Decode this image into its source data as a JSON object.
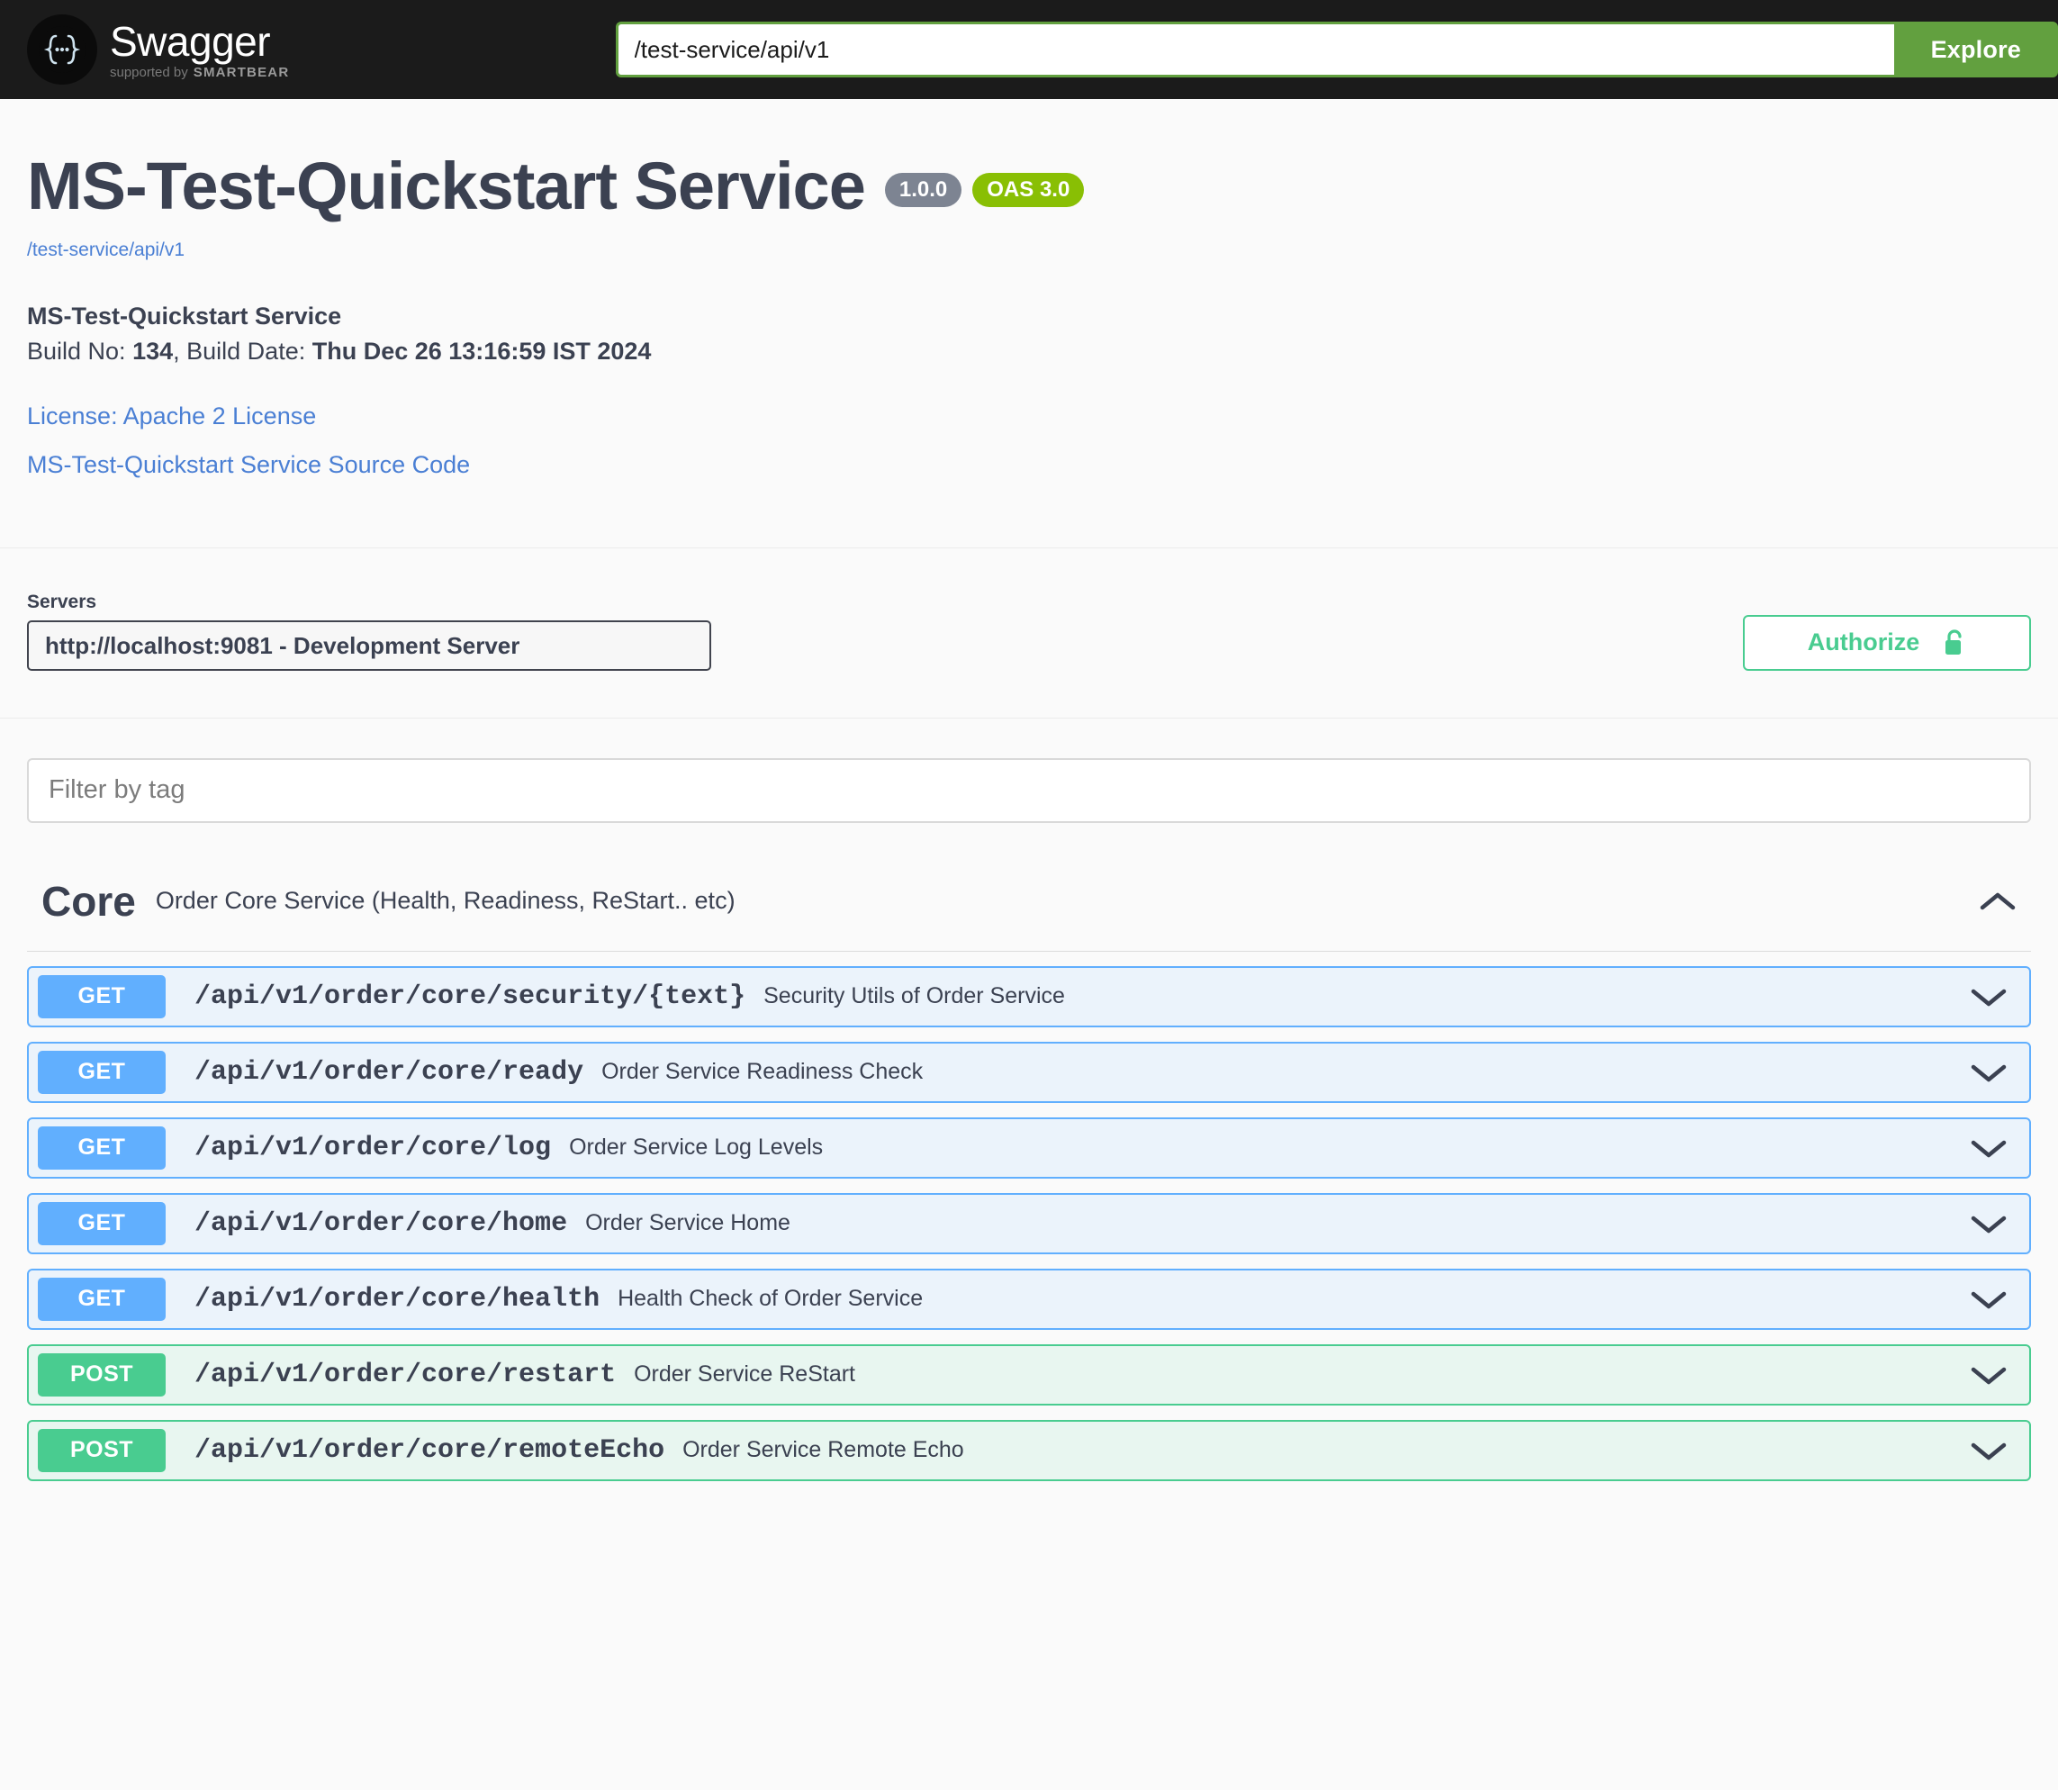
{
  "topbar": {
    "logo_title": "Swagger",
    "logo_sub_prefix": "supported by",
    "logo_sub_brand": "SMARTBEAR",
    "url_value": "/test-service/api/v1",
    "url_placeholder": "",
    "explore_label": "Explore"
  },
  "info": {
    "title": "MS-Test-Quickstart Service",
    "version_badge": "1.0.0",
    "oas_badge": "OAS 3.0",
    "base_url": "/test-service/api/v1",
    "description_title": "MS-Test-Quickstart Service",
    "build_label": "Build No:",
    "build_no": "134",
    "build_date_label": ", Build Date:",
    "build_date": "Thu Dec 26 13:16:59 IST 2024",
    "license_link": "License: Apache 2 License",
    "source_link": "MS-Test-Quickstart Service Source Code"
  },
  "servers": {
    "label": "Servers",
    "selected": "http://localhost:9081 - Development Server",
    "options": [
      "http://localhost:9081 - Development Server"
    ],
    "authorize_label": "Authorize",
    "authorize_icon": "unlock-icon"
  },
  "filter": {
    "placeholder": "Filter by tag",
    "value": ""
  },
  "tag": {
    "name": "Core",
    "description": "Order Core Service (Health, Readiness, ReStart.. etc)",
    "expanded": true,
    "toggle_icon": "chevron-up-icon"
  },
  "operations": [
    {
      "method": "GET",
      "path": "/api/v1/order/core/security/{text}",
      "summary": "Security Utils of Order Service",
      "toggle_icon": "chevron-down-icon"
    },
    {
      "method": "GET",
      "path": "/api/v1/order/core/ready",
      "summary": "Order Service Readiness Check",
      "toggle_icon": "chevron-down-icon"
    },
    {
      "method": "GET",
      "path": "/api/v1/order/core/log",
      "summary": "Order Service Log Levels",
      "toggle_icon": "chevron-down-icon"
    },
    {
      "method": "GET",
      "path": "/api/v1/order/core/home",
      "summary": "Order Service Home",
      "toggle_icon": "chevron-down-icon"
    },
    {
      "method": "GET",
      "path": "/api/v1/order/core/health",
      "summary": "Health Check of Order Service",
      "toggle_icon": "chevron-down-icon"
    },
    {
      "method": "POST",
      "path": "/api/v1/order/core/restart",
      "summary": "Order Service ReStart",
      "toggle_icon": "chevron-down-icon"
    },
    {
      "method": "POST",
      "path": "/api/v1/order/core/remoteEcho",
      "summary": "Order Service Remote Echo",
      "toggle_icon": "chevron-down-icon"
    }
  ],
  "colors": {
    "topbar_bg": "#1b1b1b",
    "explore_green": "#62a03f",
    "get_blue": "#61affe",
    "post_green": "#49cc90",
    "oas_green": "#89bf04",
    "version_gray": "#7d8492",
    "link_blue": "#4a7fd4",
    "text_dark": "#3b4151"
  }
}
